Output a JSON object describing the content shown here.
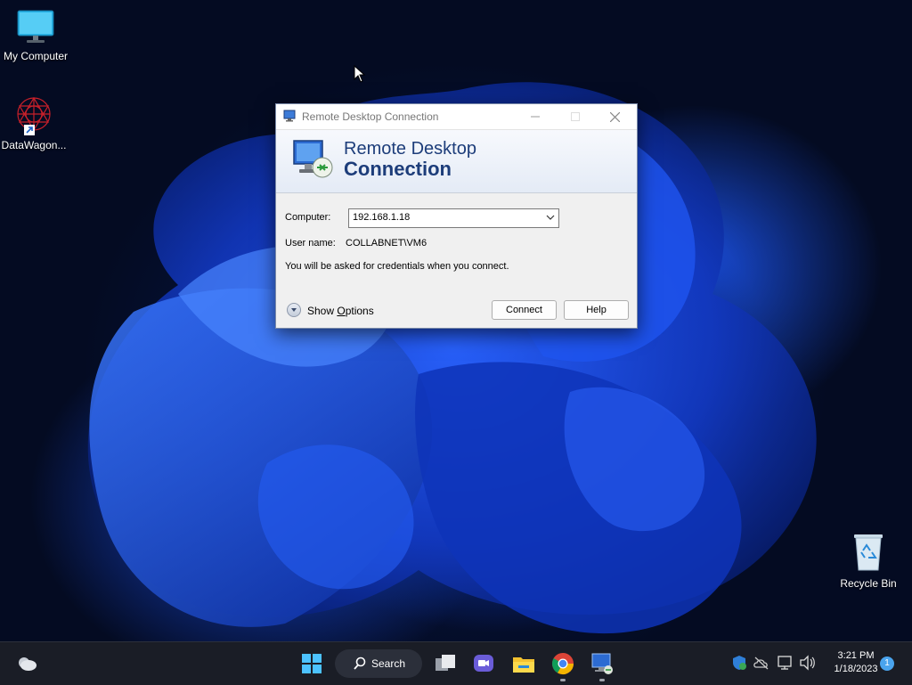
{
  "desktop": {
    "icons": [
      {
        "label": "My Computer",
        "icon": "monitor-icon"
      },
      {
        "label": "DataWagon...",
        "icon": "datawagon-icon"
      },
      {
        "label": "Recycle Bin",
        "icon": "recycle-bin-icon"
      }
    ]
  },
  "window": {
    "title": "Remote Desktop Connection",
    "banner_line1": "Remote Desktop",
    "banner_line2": "Connection",
    "computer_label": "Computer:",
    "computer_value": "192.168.1.18",
    "username_label": "User name:",
    "username_value": "COLLABNET\\VM6",
    "info_text": "You will be asked for credentials when you connect.",
    "show_options_prefix": "Show ",
    "show_options_accel": "O",
    "show_options_suffix": "ptions",
    "connect_label": "Connect",
    "help_label": "Help"
  },
  "taskbar": {
    "search_label": "Search",
    "time": "3:21 PM",
    "date": "1/18/2023",
    "notification_count": "1",
    "apps": [
      "start-icon",
      "task-view-icon",
      "chat-icon",
      "file-explorer-icon",
      "chrome-icon",
      "remote-desktop-icon"
    ]
  },
  "colors": {
    "accent": "#1d3d7a",
    "taskbar": "#1a1d26",
    "badge": "#4aa4ee"
  }
}
